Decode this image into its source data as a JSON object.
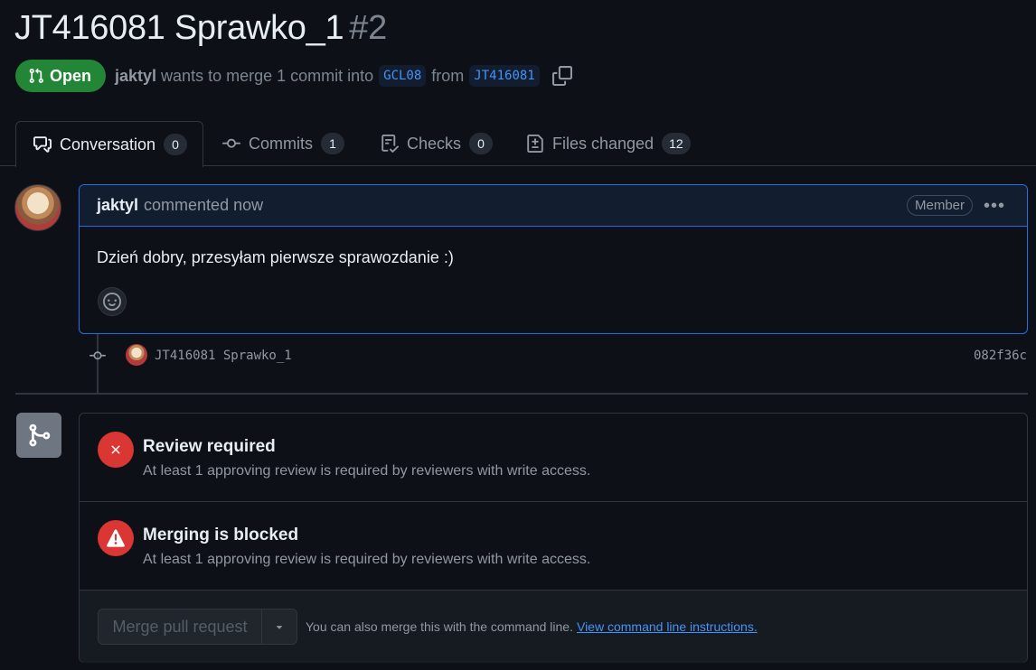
{
  "pr": {
    "title": "JT416081 Sprawko_1",
    "number": "#2",
    "state": "Open",
    "author": "jaktyl",
    "merge_text": "wants to merge 1 commit into",
    "base_branch": "GCL08",
    "from_text": "from",
    "head_branch": "JT416081"
  },
  "tabs": [
    {
      "label": "Conversation",
      "count": "0"
    },
    {
      "label": "Commits",
      "count": "1"
    },
    {
      "label": "Checks",
      "count": "0"
    },
    {
      "label": "Files changed",
      "count": "12"
    }
  ],
  "comment": {
    "author": "jaktyl",
    "action": "commented now",
    "badge": "Member",
    "more": "•••",
    "body": "Dzień dobry, przesyłam pierwsze sprawozdanie :)"
  },
  "commit": {
    "message": "JT416081 Sprawko_1",
    "sha": "082f36c"
  },
  "merge": {
    "checks": [
      {
        "title": "Review required",
        "description": "At least 1 approving review is required by reviewers with write access."
      },
      {
        "title": "Merging is blocked",
        "description": "At least 1 approving review is required by reviewers with write access."
      }
    ],
    "button_label": "Merge pull request",
    "hint_text": "You can also merge this with the command line.",
    "hint_link": "View command line instructions."
  },
  "colors": {
    "open_green": "#238636",
    "danger_red": "#da3633",
    "accent_blue": "#1f6feb",
    "link_blue": "#4493f8"
  }
}
